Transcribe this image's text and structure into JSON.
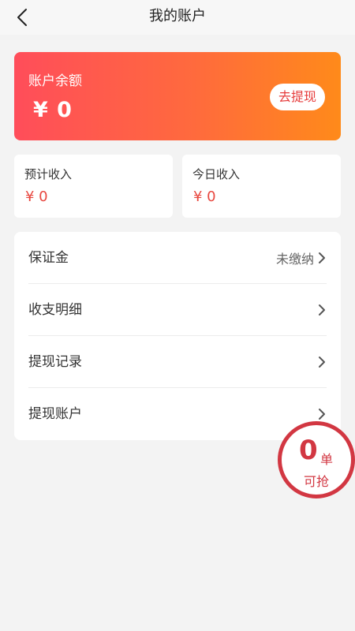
{
  "header": {
    "title": "我的账户"
  },
  "balance": {
    "label": "账户余额",
    "value": "¥ 0",
    "withdraw_label": "去提现"
  },
  "stats": [
    {
      "label": "预计收入",
      "value": "¥ 0"
    },
    {
      "label": "今日收入",
      "value": "¥ 0"
    }
  ],
  "menu": [
    {
      "label": "保证金",
      "value": "未缴纳"
    },
    {
      "label": "收支明细"
    },
    {
      "label": "提现记录"
    },
    {
      "label": "提现账户"
    }
  ],
  "float_badge": {
    "count": "0",
    "unit": "单",
    "caption": "可抢"
  },
  "colors": {
    "accent": "#e8473f",
    "gradient_start": "#ff4d5a",
    "gradient_end": "#ff8a1a",
    "badge": "#d23742"
  }
}
